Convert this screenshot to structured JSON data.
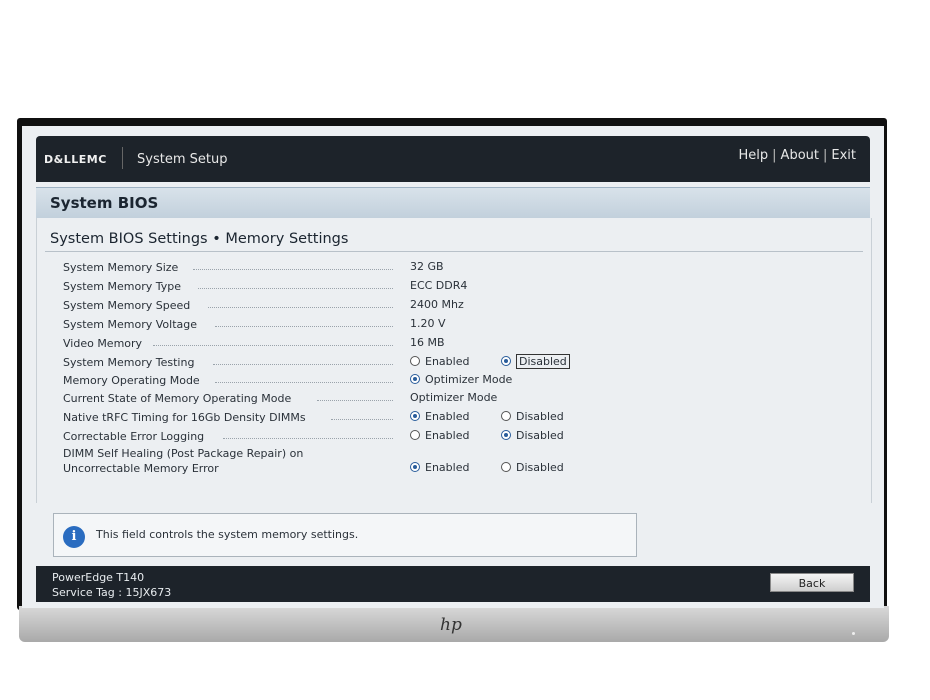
{
  "brand": "D&LLEMC",
  "app_title": "System Setup",
  "nav": {
    "help": "Help",
    "about": "About",
    "exit": "Exit",
    "separator": "|"
  },
  "section_title": "System BIOS",
  "page_title": "System BIOS Settings • Memory Settings",
  "settings": [
    {
      "label": "System Memory Size",
      "value": "32 GB"
    },
    {
      "label": "System Memory Type",
      "value": "ECC DDR4"
    },
    {
      "label": "System Memory Speed",
      "value": "2400 Mhz"
    },
    {
      "label": "System Memory Voltage",
      "value": "1.20 V"
    },
    {
      "label": "Video Memory",
      "value": "16 MB"
    },
    {
      "label": "System Memory Testing",
      "option1": "Enabled",
      "option2": "Disabled",
      "selected": "Disabled"
    },
    {
      "label": "Memory Operating Mode",
      "option1": "Optimizer Mode",
      "selected": "Optimizer Mode"
    },
    {
      "label": "Current State of Memory Operating Mode",
      "value": "Optimizer Mode"
    },
    {
      "label": "Native tRFC Timing for 16Gb Density DIMMs",
      "option1": "Enabled",
      "option2": "Disabled",
      "selected": "Enabled"
    },
    {
      "label": "Correctable Error Logging",
      "option1": "Enabled",
      "option2": "Disabled",
      "selected": "Disabled"
    },
    {
      "label_line1": "DIMM Self Healing (Post Package Repair) on",
      "label_line2": "Uncorrectable Memory Error",
      "option1": "Enabled",
      "option2": "Disabled",
      "selected": "Enabled"
    }
  ],
  "help_text": "This field controls the system memory settings.",
  "info_icon": "i",
  "footer": {
    "model": "PowerEdge T140",
    "service_tag": "Service Tag : 15JX673",
    "back_label": "Back"
  },
  "monitor_logo": "hp",
  "colors": {
    "header_bg": "#1d232a",
    "section_bg": "#c9d6e1",
    "accent": "#2a5d9c"
  }
}
